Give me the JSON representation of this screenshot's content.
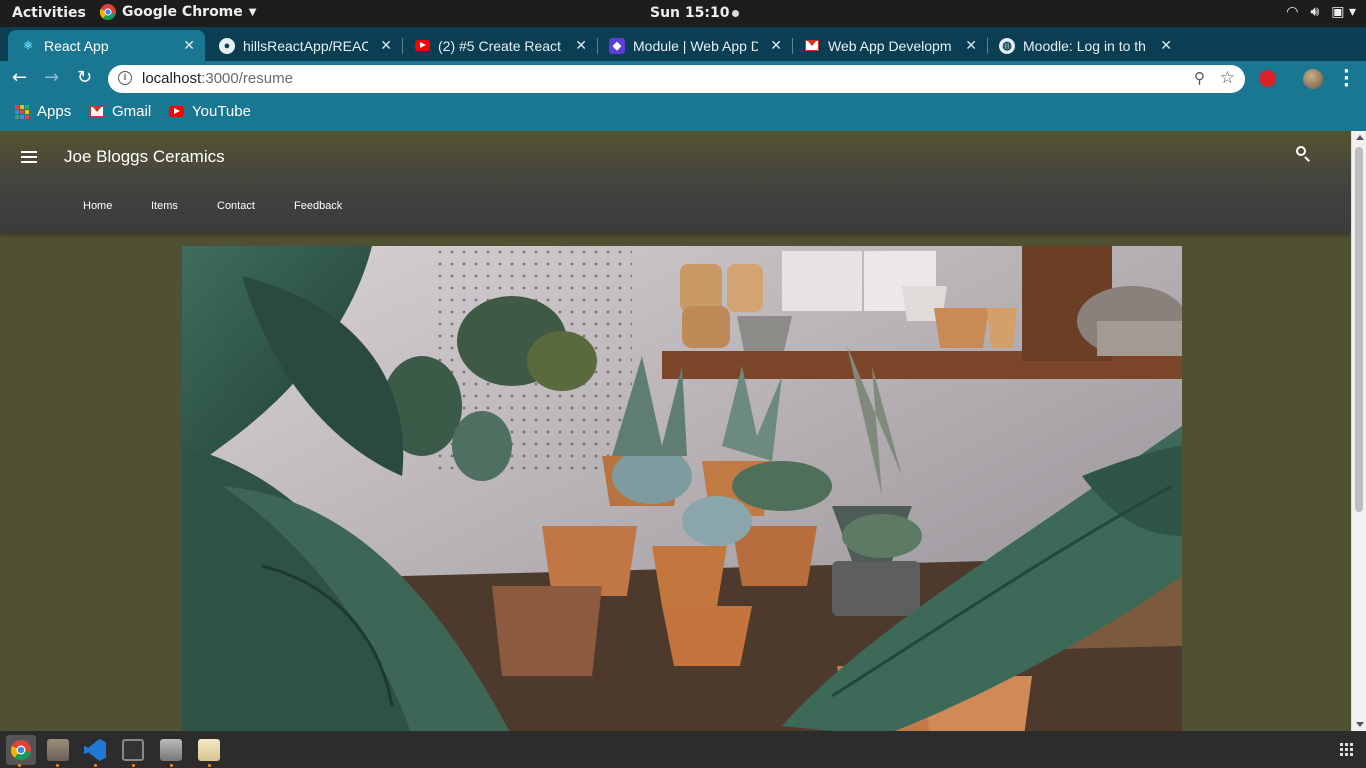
{
  "system_bar": {
    "activities": "Activities",
    "app_name": "Google Chrome",
    "clock": "Sun 15:10"
  },
  "browser": {
    "tabs": [
      {
        "title": "React App",
        "icon": "react-icon",
        "active": true
      },
      {
        "title": "hillsReactApp/REAC",
        "icon": "github-icon",
        "active": false
      },
      {
        "title": "(2) #5 Create React",
        "icon": "youtube-icon",
        "active": false
      },
      {
        "title": "Module | Web App D",
        "icon": "module-icon",
        "active": false
      },
      {
        "title": "Web App Developm",
        "icon": "gmail-icon",
        "active": false
      },
      {
        "title": "Moodle: Log in to th",
        "icon": "globe-icon",
        "active": false
      }
    ],
    "url_host": "localhost",
    "url_path": ":3000/resume",
    "bookmarks": [
      {
        "label": "Apps",
        "icon": "apps-grid-icon"
      },
      {
        "label": "Gmail",
        "icon": "gmail-icon"
      },
      {
        "label": "YouTube",
        "icon": "youtube-icon"
      }
    ]
  },
  "page": {
    "site_title": "Joe Bloggs Ceramics",
    "nav": [
      "Home",
      "Items",
      "Contact",
      "Feedback"
    ],
    "hero_image_description": "",
    "colors": {
      "header_top": "#545431",
      "header_bottom": "#3b3b3b",
      "page_background": "#4f5132"
    }
  },
  "dock": {
    "apps": [
      "chrome-icon",
      "files-icon",
      "vscode-icon",
      "terminal-icon",
      "printer-icon",
      "text-editor-icon"
    ]
  }
}
